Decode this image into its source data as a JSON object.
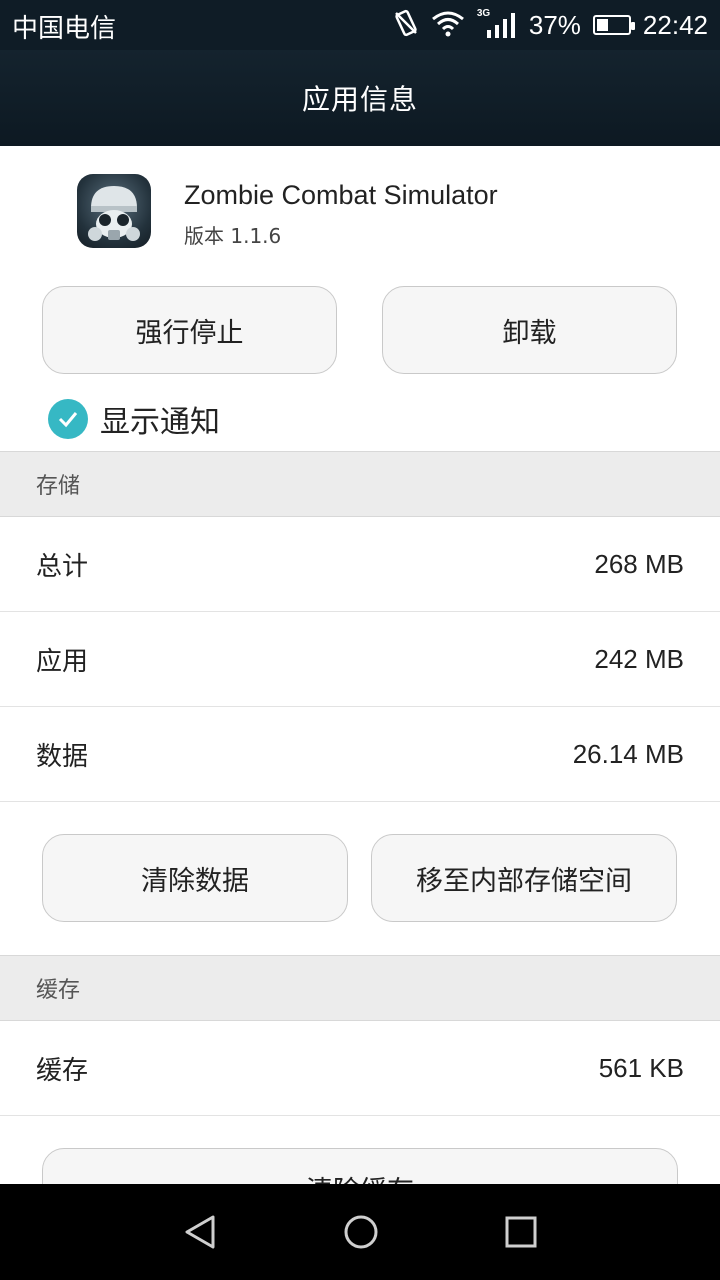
{
  "status_bar": {
    "carrier": "中国电信",
    "network": "3G",
    "battery_percent": "37%",
    "battery_level": 0.37,
    "time": "22:42"
  },
  "header": {
    "title": "应用信息"
  },
  "app": {
    "name": "Zombie Combat Simulator",
    "version": "版本 1.1.6",
    "icon": "gas-mask-soldier-icon"
  },
  "actions": {
    "force_stop": "强行停止",
    "uninstall": "卸载"
  },
  "notification": {
    "label": "显示通知",
    "checked": true
  },
  "storage": {
    "section_title": "存储",
    "rows": [
      {
        "label": "总计",
        "value": "268 MB"
      },
      {
        "label": "应用",
        "value": "242 MB"
      },
      {
        "label": "数据",
        "value": "26.14 MB"
      }
    ],
    "clear_data": "清除数据",
    "move": "移至内部存储空间"
  },
  "cache": {
    "section_title": "缓存",
    "row": {
      "label": "缓存",
      "value": "561 KB"
    },
    "clear_cache": "清除缓存"
  },
  "colors": {
    "accent": "#36b8c4",
    "header_bg": "#0f1c26"
  }
}
